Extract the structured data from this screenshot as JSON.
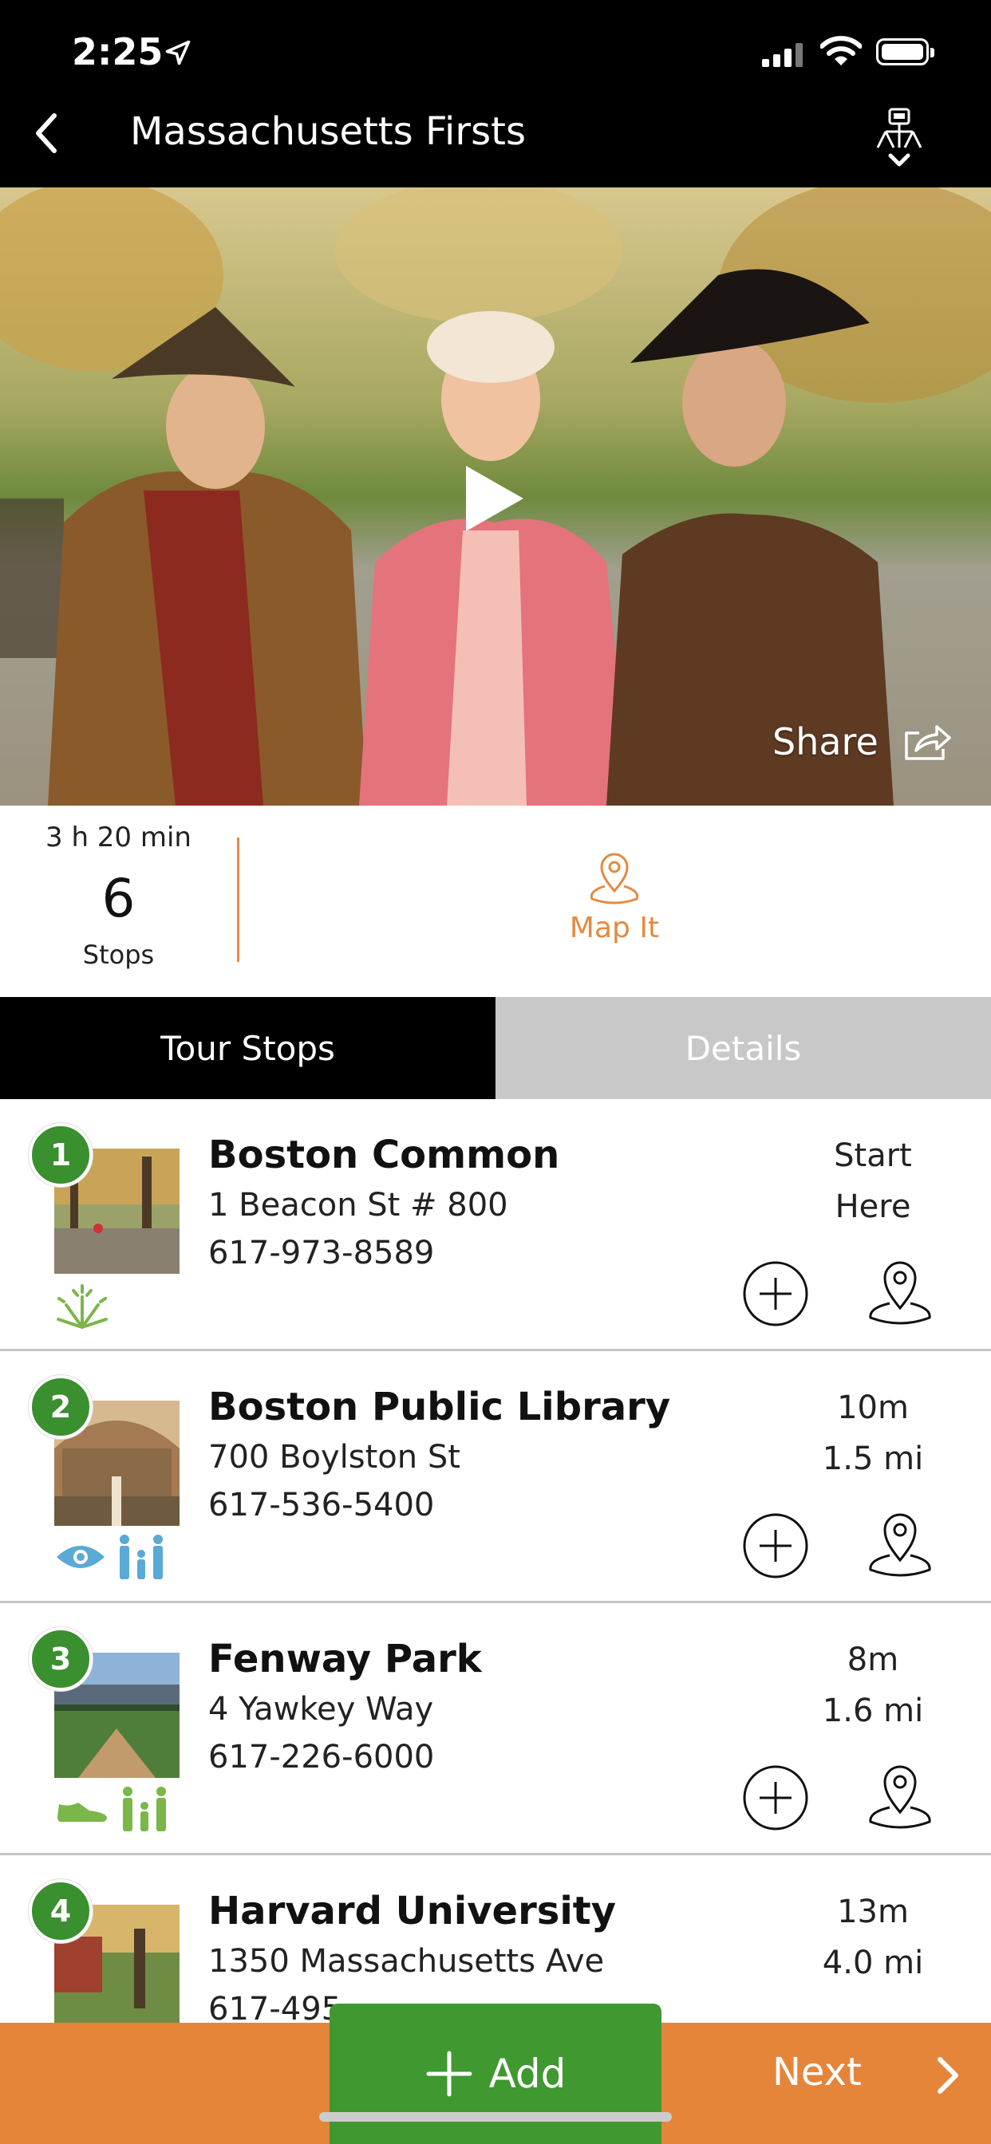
{
  "status": {
    "time": "2:25"
  },
  "nav": {
    "title": "Massachusetts Firsts"
  },
  "hero": {
    "share_label": "Share"
  },
  "summary": {
    "duration": "3 h 20 min",
    "stops_count": "6",
    "stops_label": "Stops",
    "map_label": "Map It"
  },
  "tabs": [
    {
      "label": "Tour Stops",
      "active": true
    },
    {
      "label": "Details",
      "active": false
    }
  ],
  "stops": [
    {
      "num": "1",
      "name": "Boston Common",
      "address": "1 Beacon St # 800",
      "phone": "617-973-8589",
      "line1": "Start",
      "line2": "Here",
      "amenities": [
        "fireworks-icon"
      ]
    },
    {
      "num": "2",
      "name": "Boston Public Library",
      "address": "700 Boylston St",
      "phone": "617-536-5400",
      "line1": "10m",
      "line2": "1.5 mi",
      "amenities": [
        "eye-icon",
        "family-icon"
      ]
    },
    {
      "num": "3",
      "name": "Fenway Park",
      "address": "4 Yawkey Way",
      "phone": "617-226-6000",
      "line1": "8m",
      "line2": "1.6 mi",
      "amenities": [
        "sneaker-icon",
        "family-icon"
      ]
    },
    {
      "num": "4",
      "name": "Harvard University",
      "address": "1350 Massachusetts Ave",
      "phone": "617-495",
      "line1": "13m",
      "line2": "4.0 mi",
      "amenities": []
    }
  ],
  "bottom": {
    "add_label": "Add",
    "next_label": "Next"
  },
  "colors": {
    "accent_orange": "#e5853a",
    "badge_green": "#3a8f2e",
    "add_green": "#3f9830",
    "icon_green": "#7ab648",
    "icon_blue": "#5aa9d6"
  }
}
